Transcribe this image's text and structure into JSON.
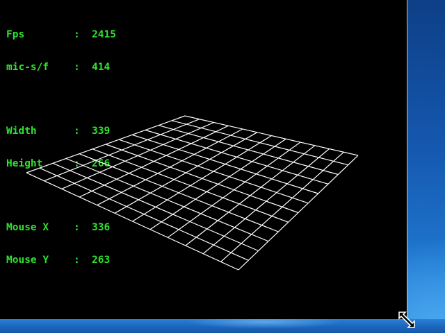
{
  "hud": {
    "rows": [
      {
        "label": "Fps",
        "sep": ":",
        "value": "2415"
      },
      {
        "label": "mic-s/f",
        "sep": ":",
        "value": "414"
      },
      {
        "label": "Width",
        "sep": ":",
        "value": "339"
      },
      {
        "label": "Height",
        "sep": ":",
        "value": "266"
      },
      {
        "label": "Mouse X",
        "sep": ":",
        "value": "336"
      },
      {
        "label": "Mouse Y",
        "sep": ":",
        "value": "263"
      }
    ]
  },
  "scene": {
    "grid_divisions": 12,
    "line_color": "#ffffff",
    "hud_color": "#2ee32e"
  },
  "cursor": {
    "icon": "resize-diagonal-icon"
  }
}
